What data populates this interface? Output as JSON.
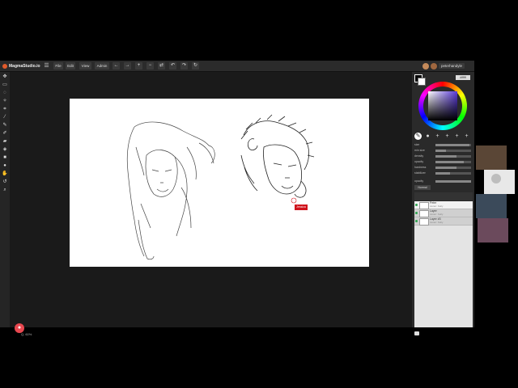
{
  "app": {
    "title": "MagmaStudio.io",
    "menu": [
      "File",
      "Edit",
      "View",
      "Admin"
    ],
    "toolbar_icons": [
      "arrow-left-icon",
      "arrow-right-icon",
      "zoom-in-icon",
      "zoom-out-icon",
      "flip-icon",
      "undo-icon",
      "redo-icon",
      "rotate-icon"
    ],
    "user": "peterhandyle",
    "zoom": "Q, 60%"
  },
  "canvas": {
    "name_tag": "Jessica"
  },
  "right_panel": {
    "hex": "#ffffff",
    "sliders": [
      {
        "label": "size",
        "value": 0.95
      },
      {
        "label": "min size",
        "value": 0.3
      },
      {
        "label": "density",
        "value": 0.6
      },
      {
        "label": "opacity",
        "value": 0.8
      },
      {
        "label": "hardness",
        "value": 0.6
      },
      {
        "label": "stabilizer",
        "value": 0.4
      }
    ],
    "opacity_label": "opacity",
    "mode": "Normal",
    "layers": [
      {
        "name": "Peter",
        "sub": "owner: Kelly"
      },
      {
        "name": "Layer",
        "sub": "owner: Kelly"
      },
      {
        "name": "Layer #3",
        "sub": "owner: Kelly"
      }
    ]
  },
  "colors": {
    "accent": "#e8474f",
    "name_tag": "#d0121b"
  }
}
